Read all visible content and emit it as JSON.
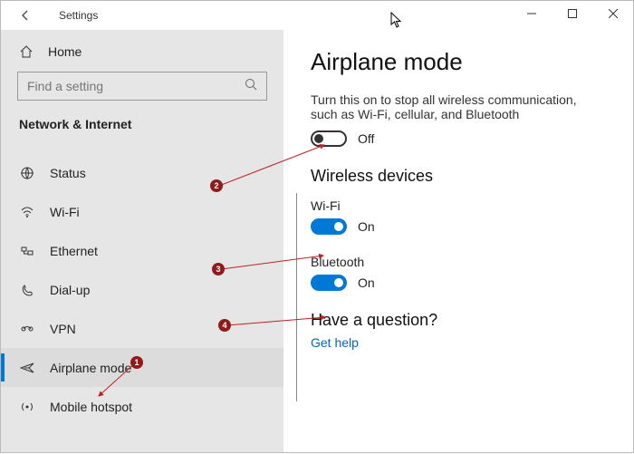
{
  "title": "Settings",
  "search": {
    "placeholder": "Find a setting"
  },
  "home_label": "Home",
  "section_label": "Network & Internet",
  "sidebar": {
    "items": [
      {
        "label": "Status"
      },
      {
        "label": "Wi-Fi"
      },
      {
        "label": "Ethernet"
      },
      {
        "label": "Dial-up"
      },
      {
        "label": "VPN"
      },
      {
        "label": "Airplane mode"
      },
      {
        "label": "Mobile hotspot"
      }
    ]
  },
  "main": {
    "title": "Airplane mode",
    "description": "Turn this on to stop all wireless communication, such as Wi-Fi, cellular, and Bluetooth",
    "airplane_state": "Off",
    "wireless_heading": "Wireless devices",
    "wifi_label": "Wi-Fi",
    "wifi_state": "On",
    "bt_label": "Bluetooth",
    "bt_state": "On",
    "question_heading": "Have a question?",
    "help_link": "Get help"
  },
  "annotations": [
    "1",
    "2",
    "3",
    "4"
  ]
}
